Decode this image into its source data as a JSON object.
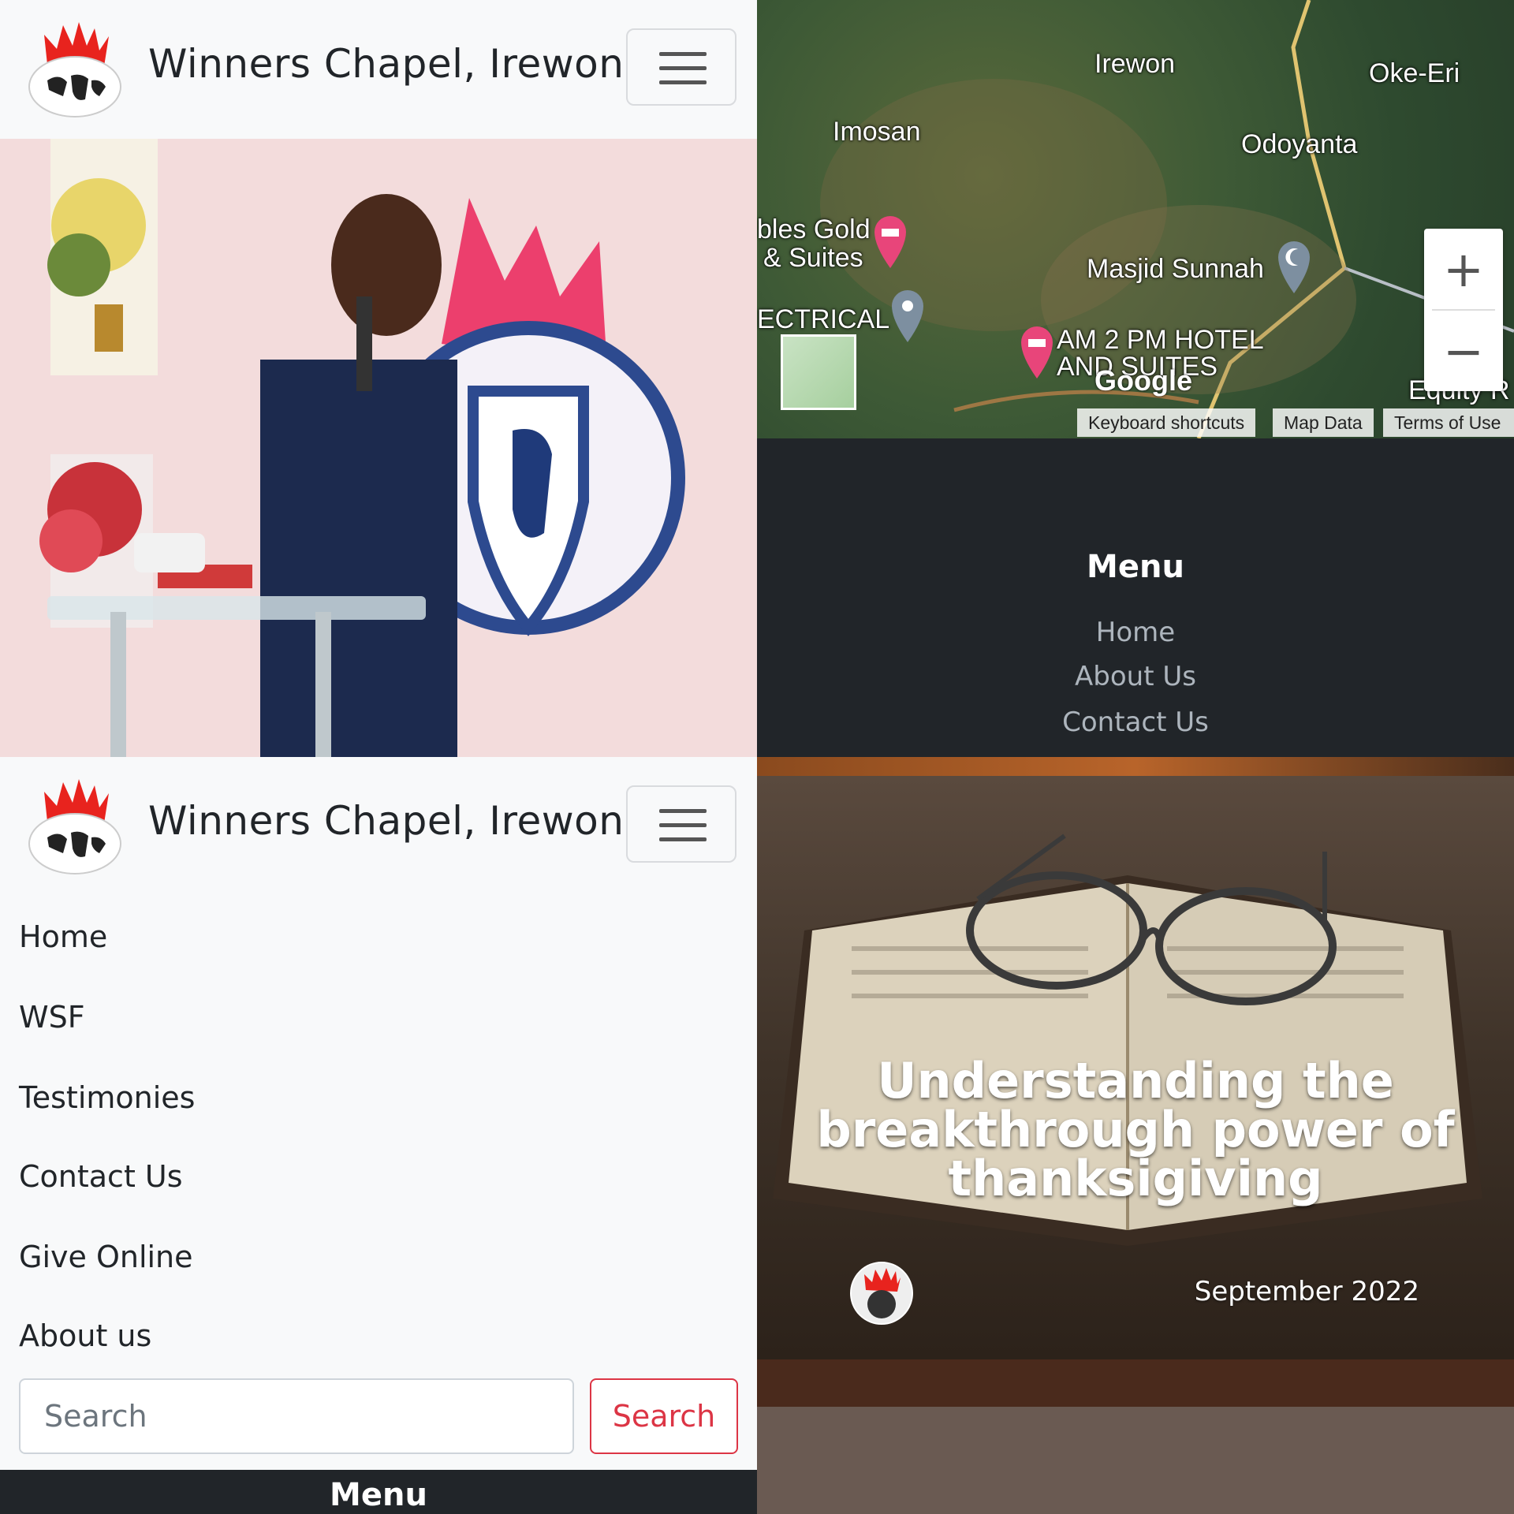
{
  "brand": {
    "name": "Winners Chapel, Irewon"
  },
  "map": {
    "labels": {
      "irewon": "Irewon",
      "oke_eri": "Oke-Eri",
      "imosan": "Imosan",
      "odoyanta": "Odoyanta",
      "gold_line1": "bles Gold",
      "gold_line2": "& Suites",
      "masjid": "Masjid Sunnah",
      "electrical": "ECTRICAL",
      "hotel_line1": "AM 2 PM HOTEL",
      "hotel_line2": "AND SUITES",
      "equity": "Equity R"
    },
    "logo": "Google",
    "attribution": {
      "keyboard": "Keyboard shortcuts",
      "map_data": "Map Data",
      "terms": "Terms of Use"
    },
    "zoom_in": "+",
    "zoom_out": "−"
  },
  "footer": {
    "title": "Menu",
    "links": [
      "Home",
      "About Us",
      "Contact Us"
    ]
  },
  "nav": {
    "items": [
      "Home",
      "WSF",
      "Testimonies",
      "Contact Us",
      "Give Online",
      "About us"
    ],
    "search_placeholder": "Search",
    "search_button": "Search",
    "menu_strip": "Menu"
  },
  "post": {
    "title": "Understanding the breakthrough power of thanksigiving",
    "date": "September 2022"
  },
  "colors": {
    "accent": "#dc3545",
    "dark": "#212529",
    "light": "#f8f9fa",
    "logo_flame": "#e8231e"
  }
}
